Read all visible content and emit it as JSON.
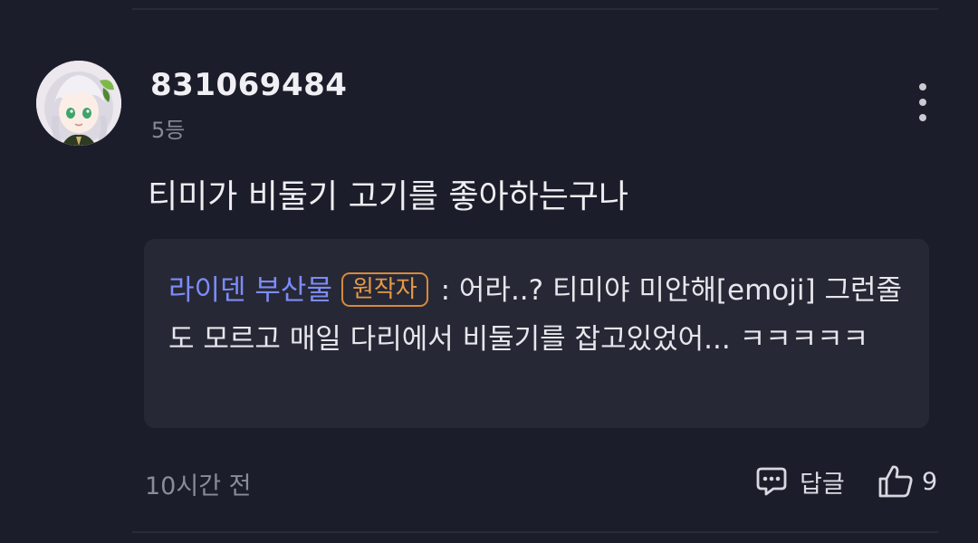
{
  "comment": {
    "username": "831069484",
    "rank": "5등",
    "text": "티미가 비둘기 고기를 좋아하는구나",
    "timestamp": "10시간 전",
    "reply_label": "답글",
    "like_count": "9",
    "more_icon": "more-vertical-icon",
    "reply_icon": "speech-bubble-icon",
    "like_icon": "thumbs-up-icon"
  },
  "quote": {
    "author": "라이덴 부산물",
    "badge": "원작자",
    "separator": " : ",
    "text": "어라..? 티미야 미안해[emoji] 그런줄도 모르고 매일 다리에서 비둘기를 잡고있었어... ㅋㅋㅋㅋㅋ"
  },
  "colors": {
    "background": "#1c1d2a",
    "quote_background": "#272835",
    "author_link": "#7c8cf8",
    "badge_orange": "#e39a4a"
  }
}
